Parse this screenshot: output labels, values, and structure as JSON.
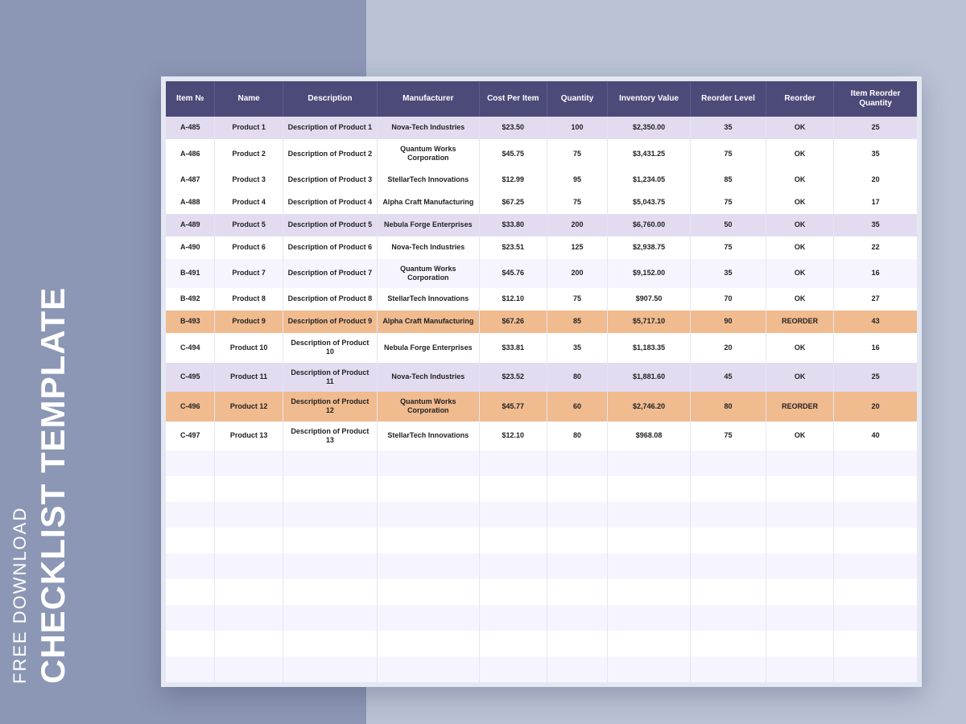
{
  "sidebar": {
    "line1": "FREE DOWNLOAD",
    "line2": "CHECKLIST TEMPLATE"
  },
  "table": {
    "headers": [
      "Item №",
      "Name",
      "Description",
      "Manufacturer",
      "Cost Per Item",
      "Quantity",
      "Inventory Value",
      "Reorder Level",
      "Reorder",
      "Item Reorder Quantity"
    ],
    "rows": [
      {
        "style": "violet",
        "cells": [
          "A-485",
          "Product 1",
          "Description of Product 1",
          "Nova-Tech Industries",
          "$23.50",
          "100",
          "$2,350.00",
          "35",
          "OK",
          "25"
        ]
      },
      {
        "style": "plain",
        "cells": [
          "A-486",
          "Product 2",
          "Description of Product 2",
          "Quantum Works Corporation",
          "$45.75",
          "75",
          "$3,431.25",
          "75",
          "OK",
          "35"
        ]
      },
      {
        "style": "plain",
        "cells": [
          "A-487",
          "Product 3",
          "Description of Product 3",
          "StellarTech Innovations",
          "$12.99",
          "95",
          "$1,234.05",
          "85",
          "OK",
          "20"
        ]
      },
      {
        "style": "plain",
        "cells": [
          "A-488",
          "Product 4",
          "Description of Product 4",
          "Alpha Craft Manufacturing",
          "$67.25",
          "75",
          "$5,043.75",
          "75",
          "OK",
          "17"
        ]
      },
      {
        "style": "violet",
        "cells": [
          "A-489",
          "Product 5",
          "Description of Product 5",
          "Nebula Forge Enterprises",
          "$33.80",
          "200",
          "$6,760.00",
          "50",
          "OK",
          "35"
        ]
      },
      {
        "style": "plain",
        "cells": [
          "A-490",
          "Product 6",
          "Description of Product 6",
          "Nova-Tech Industries",
          "$23.51",
          "125",
          "$2,938.75",
          "75",
          "OK",
          "22"
        ]
      },
      {
        "style": "faint",
        "cells": [
          "B-491",
          "Product 7",
          "Description of Product 7",
          "Quantum Works Corporation",
          "$45.76",
          "200",
          "$9,152.00",
          "35",
          "OK",
          "16"
        ]
      },
      {
        "style": "plain",
        "cells": [
          "B-492",
          "Product 8",
          "Description of Product 8",
          "StellarTech Innovations",
          "$12.10",
          "75",
          "$907.50",
          "70",
          "OK",
          "27"
        ]
      },
      {
        "style": "orange",
        "cells": [
          "B-493",
          "Product 9",
          "Description of Product 9",
          "Alpha Craft Manufacturing",
          "$67.26",
          "85",
          "$5,717.10",
          "90",
          "REORDER",
          "43"
        ]
      },
      {
        "style": "plain",
        "cells": [
          "C-494",
          "Product 10",
          "Description of Product 10",
          "Nebula Forge Enterprises",
          "$33.81",
          "35",
          "$1,183.35",
          "20",
          "OK",
          "16"
        ]
      },
      {
        "style": "violet",
        "cells": [
          "C-495",
          "Product 11",
          "Description of Product 11",
          "Nova-Tech Industries",
          "$23.52",
          "80",
          "$1,881.60",
          "45",
          "OK",
          "25"
        ]
      },
      {
        "style": "orange",
        "cells": [
          "C-496",
          "Product 12",
          "Description of Product 12",
          "Quantum Works Corporation",
          "$45.77",
          "60",
          "$2,746.20",
          "80",
          "REORDER",
          "20"
        ]
      },
      {
        "style": "plain",
        "cells": [
          "C-497",
          "Product 13",
          "Description of Product 13",
          "StellarTech Innovations",
          "$12.10",
          "80",
          "$968.08",
          "75",
          "OK",
          "40"
        ]
      }
    ],
    "emptyRows": 9
  },
  "colors": {
    "headerBg": "#4c4a78",
    "violetRow": "#e3dcf1",
    "orangeRow": "#f0bb8f",
    "bgLeft": "#8c97b5",
    "bgRight": "#bac2d6"
  }
}
